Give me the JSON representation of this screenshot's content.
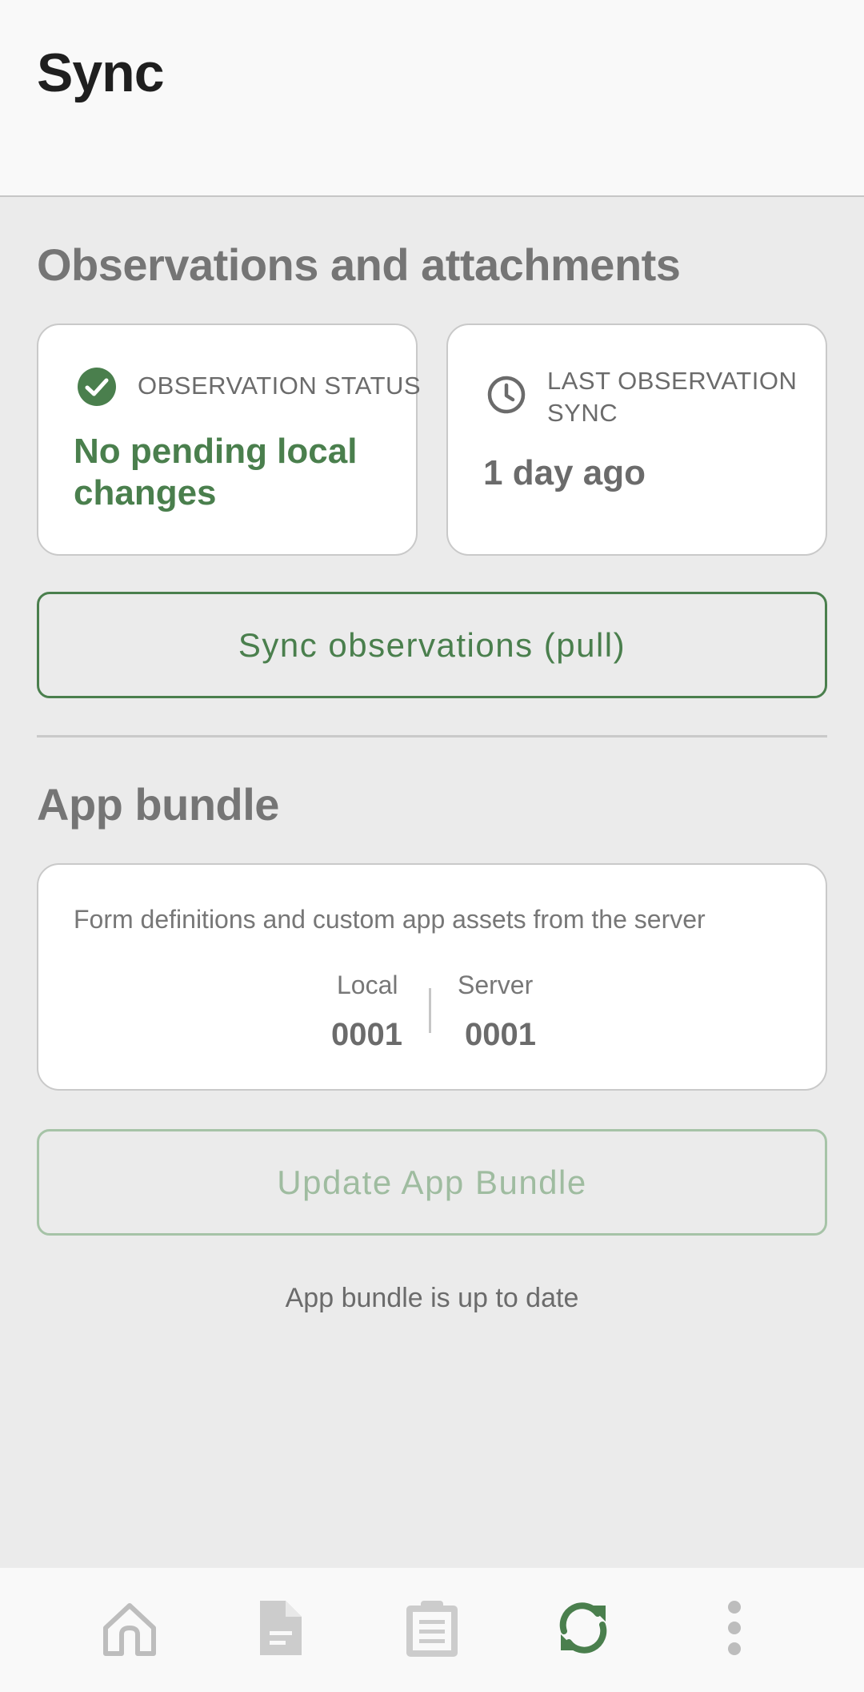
{
  "header": {
    "title": "Sync"
  },
  "observations": {
    "section_title": "Observations and attachments",
    "status_card": {
      "label": "OBSERVATION STATUS",
      "value": "No pending local changes",
      "icon": "check-circle-icon"
    },
    "last_sync_card": {
      "label_line1": "LAST OBSERVATION",
      "label_line2": "SYNC",
      "value": "1 day ago",
      "icon": "clock-icon"
    },
    "sync_button_label": "Sync observations (pull)"
  },
  "app_bundle": {
    "section_title": "App bundle",
    "description": "Form definitions and custom app assets from the server",
    "local_label": "Local",
    "local_value": "0001",
    "server_label": "Server",
    "server_value": "0001",
    "update_button_label": "Update App Bundle",
    "status_note": "App bundle is up to date"
  },
  "bottom_nav": {
    "items": [
      {
        "name": "home",
        "icon": "home-icon"
      },
      {
        "name": "document",
        "icon": "document-icon"
      },
      {
        "name": "clipboard",
        "icon": "clipboard-icon"
      },
      {
        "name": "sync",
        "icon": "sync-icon",
        "active": true
      },
      {
        "name": "more",
        "icon": "more-vertical-icon"
      }
    ]
  },
  "colors": {
    "accent": "#4a7f4d",
    "accent_disabled": "#a6c3a7",
    "text_muted": "#6b6b6b",
    "background": "#ebebeb",
    "card": "#ffffff"
  }
}
